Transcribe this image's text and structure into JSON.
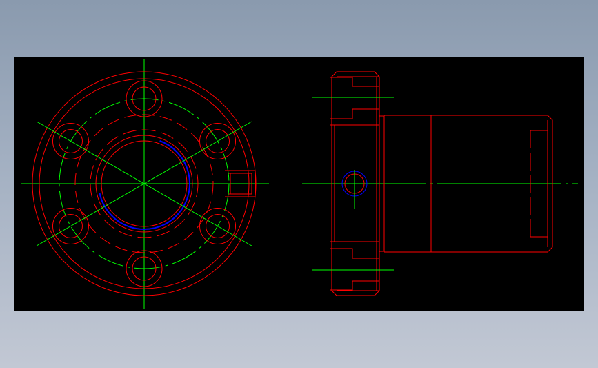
{
  "colors": {
    "background": "#000000",
    "outline": "#ff0000",
    "centerline": "#00ff00",
    "thread": "#0000ff"
  },
  "drawing": {
    "views": [
      "front-view",
      "side-view"
    ],
    "front_view": {
      "bolt_hole_count": 6,
      "pitch_circle": "dash-dot",
      "lube_port": "right"
    },
    "side_view": {
      "flange": "left",
      "body": "cylindrical",
      "lube_port": "center"
    }
  }
}
